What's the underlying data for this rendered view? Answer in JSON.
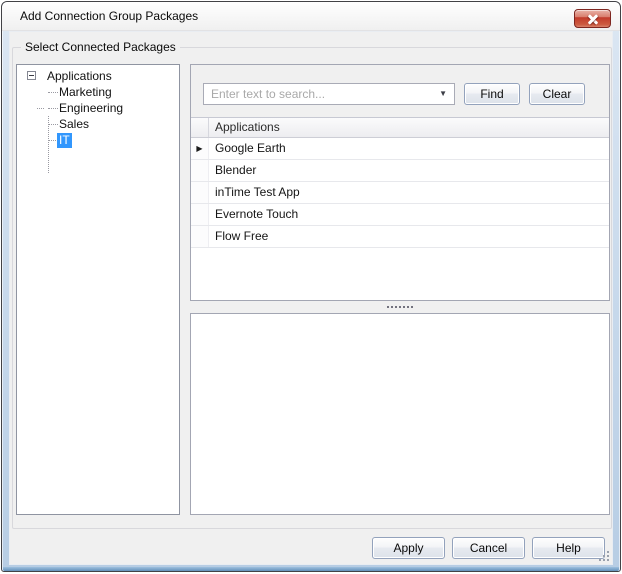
{
  "window": {
    "title": "Add Connection Group Packages"
  },
  "group_box": {
    "label": "Select Connected Packages"
  },
  "tree": {
    "root": {
      "label": "Applications",
      "expanded": true
    },
    "items": [
      {
        "label": "Marketing",
        "selected": false
      },
      {
        "label": "Engineering",
        "selected": false
      },
      {
        "label": "Sales",
        "selected": false
      },
      {
        "label": "IT",
        "selected": true
      }
    ]
  },
  "search": {
    "placeholder": "Enter text to search...",
    "find_label": "Find",
    "clear_label": "Clear"
  },
  "grid": {
    "column_header": "Applications",
    "rows": [
      {
        "name": "Google Earth",
        "active": true
      },
      {
        "name": "Blender",
        "active": false
      },
      {
        "name": "inTime Test App",
        "active": false
      },
      {
        "name": "Evernote Touch",
        "active": false
      },
      {
        "name": "Flow Free",
        "active": false
      }
    ]
  },
  "footer": {
    "apply_label": "Apply",
    "cancel_label": "Cancel",
    "help_label": "Help"
  },
  "icons": {
    "dropdown": "▼",
    "row_indicator": "▶"
  },
  "colors": {
    "selection_blue": "#3297fd",
    "close_red": "#c44437",
    "frame_blue": "#bfd4e9",
    "dialog_bg": "#f0f0f0"
  }
}
